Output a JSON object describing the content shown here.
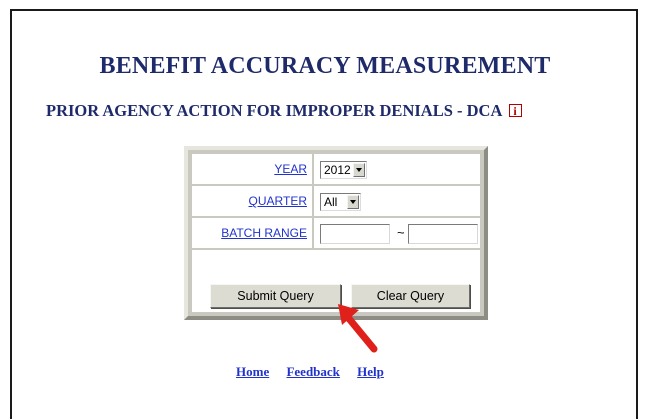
{
  "page": {
    "title": "BENEFIT ACCURACY MEASUREMENT",
    "subtitle": "PRIOR AGENCY ACTION FOR IMPROPER DENIALS - DCA",
    "info_icon_glyph": "i"
  },
  "form": {
    "year": {
      "label": "YEAR",
      "value": "2012"
    },
    "quarter": {
      "label": "QUARTER",
      "value": "All"
    },
    "batch_range": {
      "label": "BATCH RANGE",
      "from": "",
      "to": "",
      "separator": "~"
    },
    "submit_label": "Submit Query",
    "clear_label": "Clear Query"
  },
  "annotation": {
    "arrow_color": "#e0201a"
  },
  "footer": {
    "links": [
      "Home",
      "Feedback",
      "Help"
    ]
  },
  "colors": {
    "heading": "#1f2a6a",
    "link": "#2233cc",
    "panel_border": "#c9c9c0",
    "info_icon": "#b00000"
  }
}
